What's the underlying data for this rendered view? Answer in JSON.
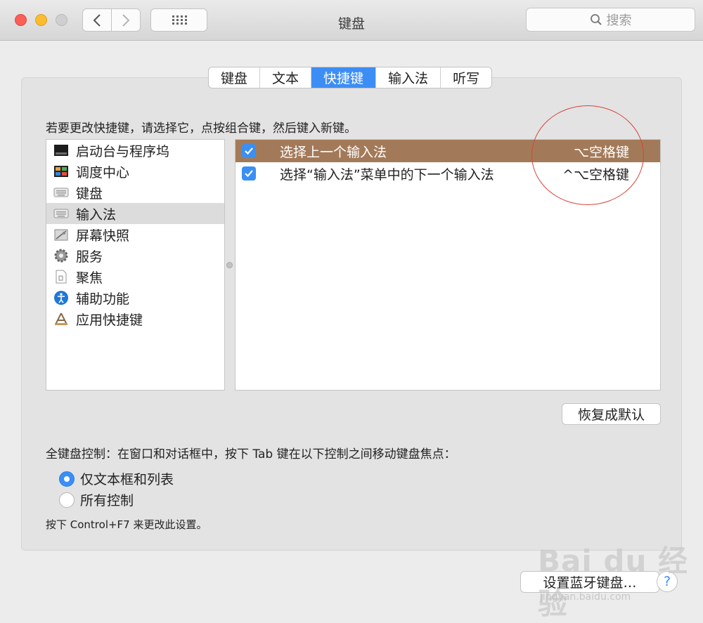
{
  "window": {
    "title": "键盘",
    "search_placeholder": "搜索"
  },
  "tabs": [
    {
      "label": "键盘",
      "active": false
    },
    {
      "label": "文本",
      "active": false
    },
    {
      "label": "快捷键",
      "active": true
    },
    {
      "label": "输入法",
      "active": false
    },
    {
      "label": "听写",
      "active": false
    }
  ],
  "instruction": "若要更改快捷键，请选择它，点按组合键，然后键入新键。",
  "categories": [
    {
      "label": "启动台与程序坞",
      "icon": "launchpad-dock-icon"
    },
    {
      "label": "调度中心",
      "icon": "mission-control-icon"
    },
    {
      "label": "键盘",
      "icon": "keyboard-icon"
    },
    {
      "label": "输入法",
      "icon": "keyboard-icon",
      "selected": true
    },
    {
      "label": "屏幕快照",
      "icon": "screenshot-icon"
    },
    {
      "label": "服务",
      "icon": "gear-icon"
    },
    {
      "label": "聚焦",
      "icon": "document-icon"
    },
    {
      "label": "辅助功能",
      "icon": "accessibility-icon"
    },
    {
      "label": "应用快捷键",
      "icon": "app-shortcut-icon"
    }
  ],
  "shortcuts": [
    {
      "label": "选择上一个输入法",
      "key": "⌥空格键",
      "checked": true,
      "selected": true
    },
    {
      "label": "选择“输入法”菜单中的下一个输入法",
      "key": "^⌥空格键",
      "checked": true,
      "selected": false
    }
  ],
  "restore_button": "恢复成默认",
  "full_keyboard": {
    "title": "全键盘控制：在窗口和对话框中，按下 Tab 键在以下控制之间移动键盘焦点：",
    "options": [
      {
        "label": "仅文本框和列表",
        "selected": true
      },
      {
        "label": "所有控制",
        "selected": false
      }
    ],
    "hint": "按下 Control+F7 来更改此设置。"
  },
  "bluetooth_button": "设置蓝牙键盘…",
  "help_button": "?",
  "watermark": {
    "brand": "Bai du 经验",
    "url": "jingyan.baidu.com"
  },
  "colors": {
    "accent": "#3c8ef5",
    "selected_row": "#a37a59",
    "annotation_circle": "#d6443c"
  }
}
